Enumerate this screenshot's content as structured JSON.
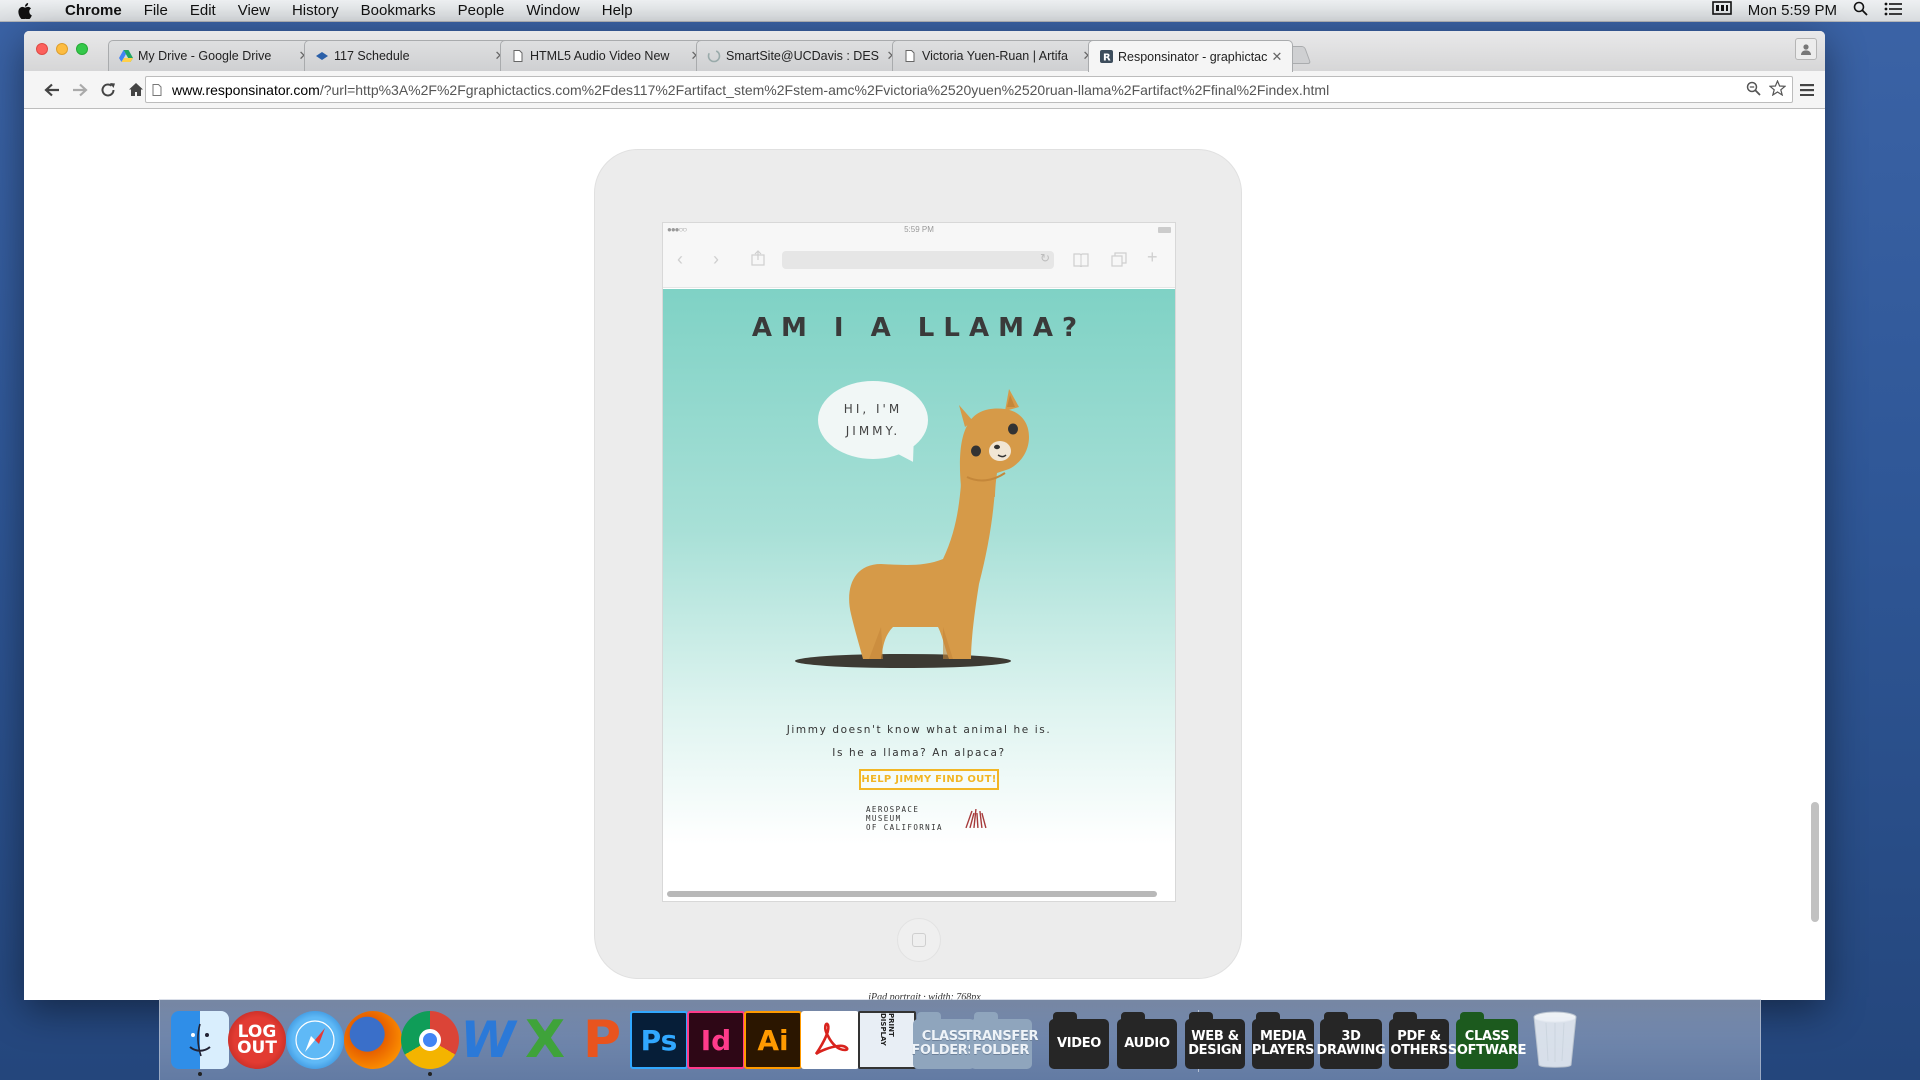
{
  "menubar": {
    "app_name": "Chrome",
    "items": [
      "File",
      "Edit",
      "View",
      "History",
      "Bookmarks",
      "People",
      "Window",
      "Help"
    ],
    "clock": "Mon 5:59 PM"
  },
  "tabs": [
    {
      "label": "My Drive - Google Drive",
      "icon": "google-drive-icon",
      "active": false
    },
    {
      "label": "117 Schedule",
      "icon": "bookmark-icon",
      "active": false
    },
    {
      "label": "HTML5 Audio Video New",
      "icon": "page-icon",
      "active": false
    },
    {
      "label": "SmartSite@UCDavis : DES",
      "icon": "loading-icon",
      "active": false
    },
    {
      "label": "Victoria Yuen-Ruan | Artifa",
      "icon": "page-icon",
      "active": false
    },
    {
      "label": "Responsinator - graphictac",
      "icon": "responsinator-icon",
      "active": true
    }
  ],
  "omnibox": {
    "host": "www.responsinator.com",
    "path": "/?url=http%3A%2F%2Fgraphictactics.com%2Fdes117%2Fartifact_stem%2Fstem-amc%2Fvictoria%2520yuen%2520ruan-llama%2Fartifact%2Ffinal%2Findex.html"
  },
  "ipad": {
    "status_time": "5:59 PM",
    "status_signal": "●●●○○"
  },
  "site": {
    "title": "AM I A LLAMA?",
    "bubble_line1": "HI, I'M",
    "bubble_line2": "JIMMY.",
    "desc_line1": "Jimmy doesn't know what animal he is.",
    "desc_line2": "Is he a llama? An alpaca?",
    "cta": "HELP JIMMY FIND OUT!",
    "logo_line1": "AEROSPACE MUSEUM",
    "logo_line2": "OF CALIFORNIA"
  },
  "device_caption": "iPad portrait · width: 768px",
  "dock": {
    "apps": [
      {
        "name": "Finder",
        "label": ""
      },
      {
        "name": "Log Out",
        "label": "LOG OUT"
      },
      {
        "name": "Safari",
        "label": ""
      },
      {
        "name": "Firefox",
        "label": ""
      },
      {
        "name": "Chrome",
        "label": ""
      },
      {
        "name": "Word",
        "label": "W"
      },
      {
        "name": "Excel",
        "label": "X"
      },
      {
        "name": "PowerPoint",
        "label": "P"
      },
      {
        "name": "Photoshop",
        "label": "Ps"
      },
      {
        "name": "InDesign",
        "label": "Id"
      },
      {
        "name": "Illustrator",
        "label": "Ai"
      },
      {
        "name": "Acrobat",
        "label": ""
      },
      {
        "name": "Print Display",
        "label": "PRINT DISPLAY"
      }
    ],
    "folders_light": [
      "CLASS FOLDERS",
      "TRANSFER FOLDER"
    ],
    "folders_dark": [
      "VIDEO",
      "AUDIO",
      "WEB & DESIGN",
      "MEDIA PLAYERS",
      "3D DRAWING",
      "PDF & OTHERS"
    ],
    "folder_green": "CLASS SOFTWARE"
  },
  "colors": {
    "site_bg_top": "#7fd2c5",
    "cta": "#f2b625",
    "llama": "#d69a48"
  }
}
